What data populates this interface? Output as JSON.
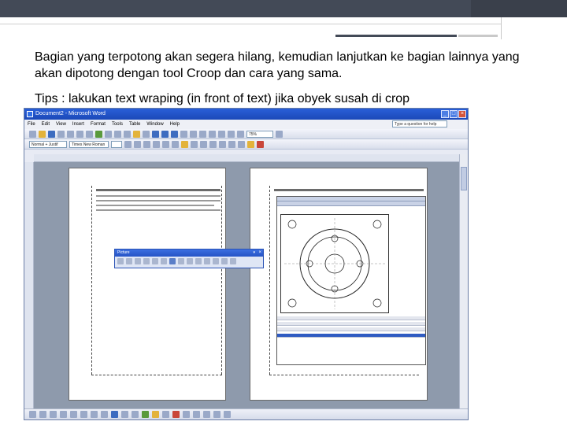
{
  "slide": {
    "paragraph_1": "Bagian yang terpotong akan segera hilang, kemudian lanjutkan ke bagian lainnya yang akan dipotong dengan tool Croop dan cara yang sama.",
    "paragraph_2": "Tips : lakukan text wraping (in front of text) jika obyek susah di crop"
  },
  "word_window": {
    "title": "Document2 - Microsoft Word",
    "menu": [
      "File",
      "Edit",
      "View",
      "Insert",
      "Format",
      "Tools",
      "Table",
      "Window",
      "Help"
    ],
    "help_box_placeholder": "Type a question for help",
    "style_combo": "Normal + Justif",
    "font_combo": "Times New Roman",
    "zoom": "75%",
    "picture_toolbar_title": "Picture",
    "picture_toolbar_buttons": [
      "insert-picture",
      "color",
      "more-contrast",
      "less-contrast",
      "more-brightness",
      "less-brightness",
      "crop",
      "rotate",
      "line-style",
      "compress",
      "text-wrapping",
      "format-picture",
      "set-transparent",
      "reset-picture"
    ]
  },
  "colors": {
    "slide_header": "#434a57",
    "word_titlebar": "#2a5fd8",
    "workspace": "#8e9aac"
  }
}
